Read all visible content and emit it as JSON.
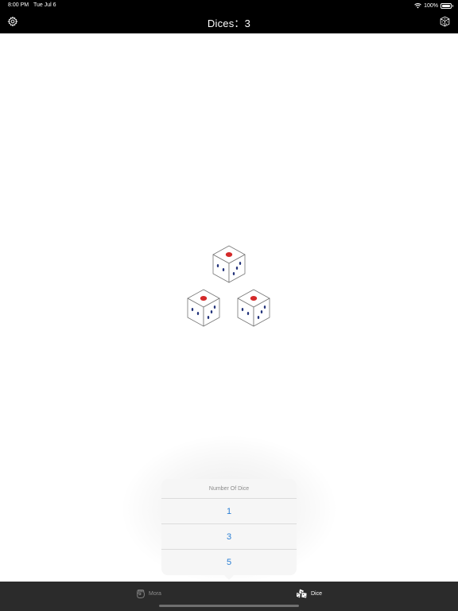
{
  "status_bar": {
    "time": "8:00 PM",
    "date": "Tue Jul 6",
    "battery": "100%",
    "battery_level": 1.0
  },
  "nav": {
    "title_label": "Dices：",
    "dice_count": "3",
    "settings_icon": "gear-icon",
    "dice_icon": "cube-icon"
  },
  "dice": {
    "count": 3,
    "faces_visible": [
      1,
      3,
      4
    ],
    "pip_colors": {
      "one": "#d42a2a",
      "other": "#23337a"
    }
  },
  "popover": {
    "title": "Number Of Dice",
    "options": [
      "1",
      "3",
      "5"
    ]
  },
  "tabbar": {
    "tabs": [
      {
        "label": "Mora",
        "icon": "fist-icon",
        "selected": false
      },
      {
        "label": "Dice",
        "icon": "dice-icon",
        "selected": true
      }
    ]
  },
  "colors": {
    "header_bg": "#000000",
    "tabbar_bg": "#2b2b2b",
    "option_text": "#2b7fd4"
  }
}
